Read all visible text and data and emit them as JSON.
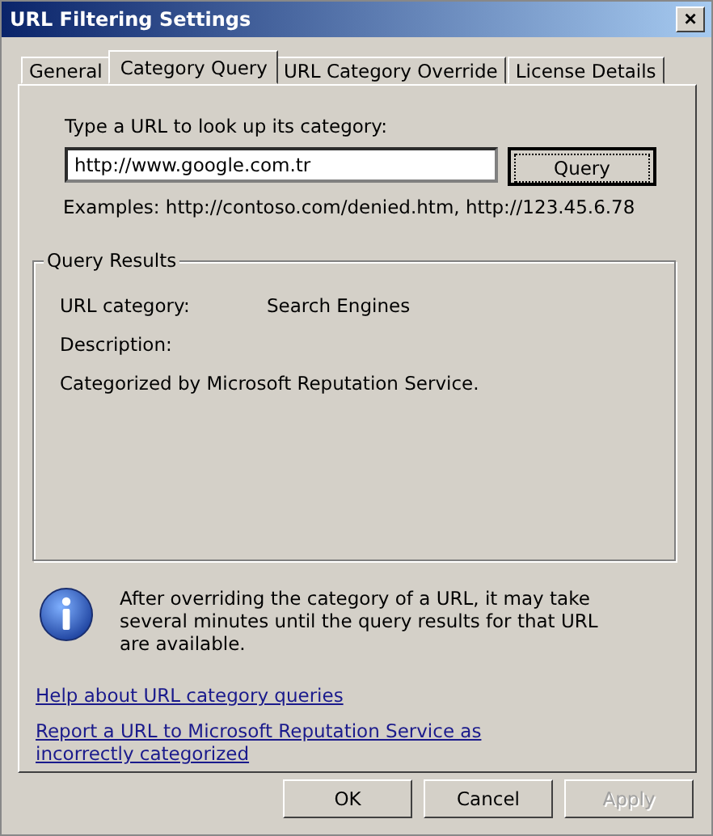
{
  "window": {
    "title": "URL Filtering Settings",
    "close": "×"
  },
  "tabs": [
    {
      "label": "General",
      "selected": false
    },
    {
      "label": "Category Query",
      "selected": true
    },
    {
      "label": "URL Category Override",
      "selected": false
    },
    {
      "label": "License Details",
      "selected": false
    }
  ],
  "lookup": {
    "label": "Type a URL to look up its category:",
    "value": "http://www.google.com.tr",
    "button": "Query",
    "examples": "Examples: http://contoso.com/denied.htm, http://123.45.6.78"
  },
  "query_results": {
    "title": "Query Results",
    "rows": [
      {
        "label": "URL category:",
        "value": "Search Engines"
      },
      {
        "label": "Description:"
      }
    ],
    "note": "Categorized by Microsoft Reputation Service."
  },
  "info": "After overriding the category of a URL, it may take several minutes until the query results for that URL are available.",
  "links": [
    "Help about URL category queries",
    "Report a URL to Microsoft Reputation Service as incorrectly categorized"
  ],
  "buttons": [
    {
      "label": "OK",
      "disabled": false
    },
    {
      "label": "Cancel",
      "disabled": false
    },
    {
      "label": "Apply",
      "disabled": true
    }
  ]
}
